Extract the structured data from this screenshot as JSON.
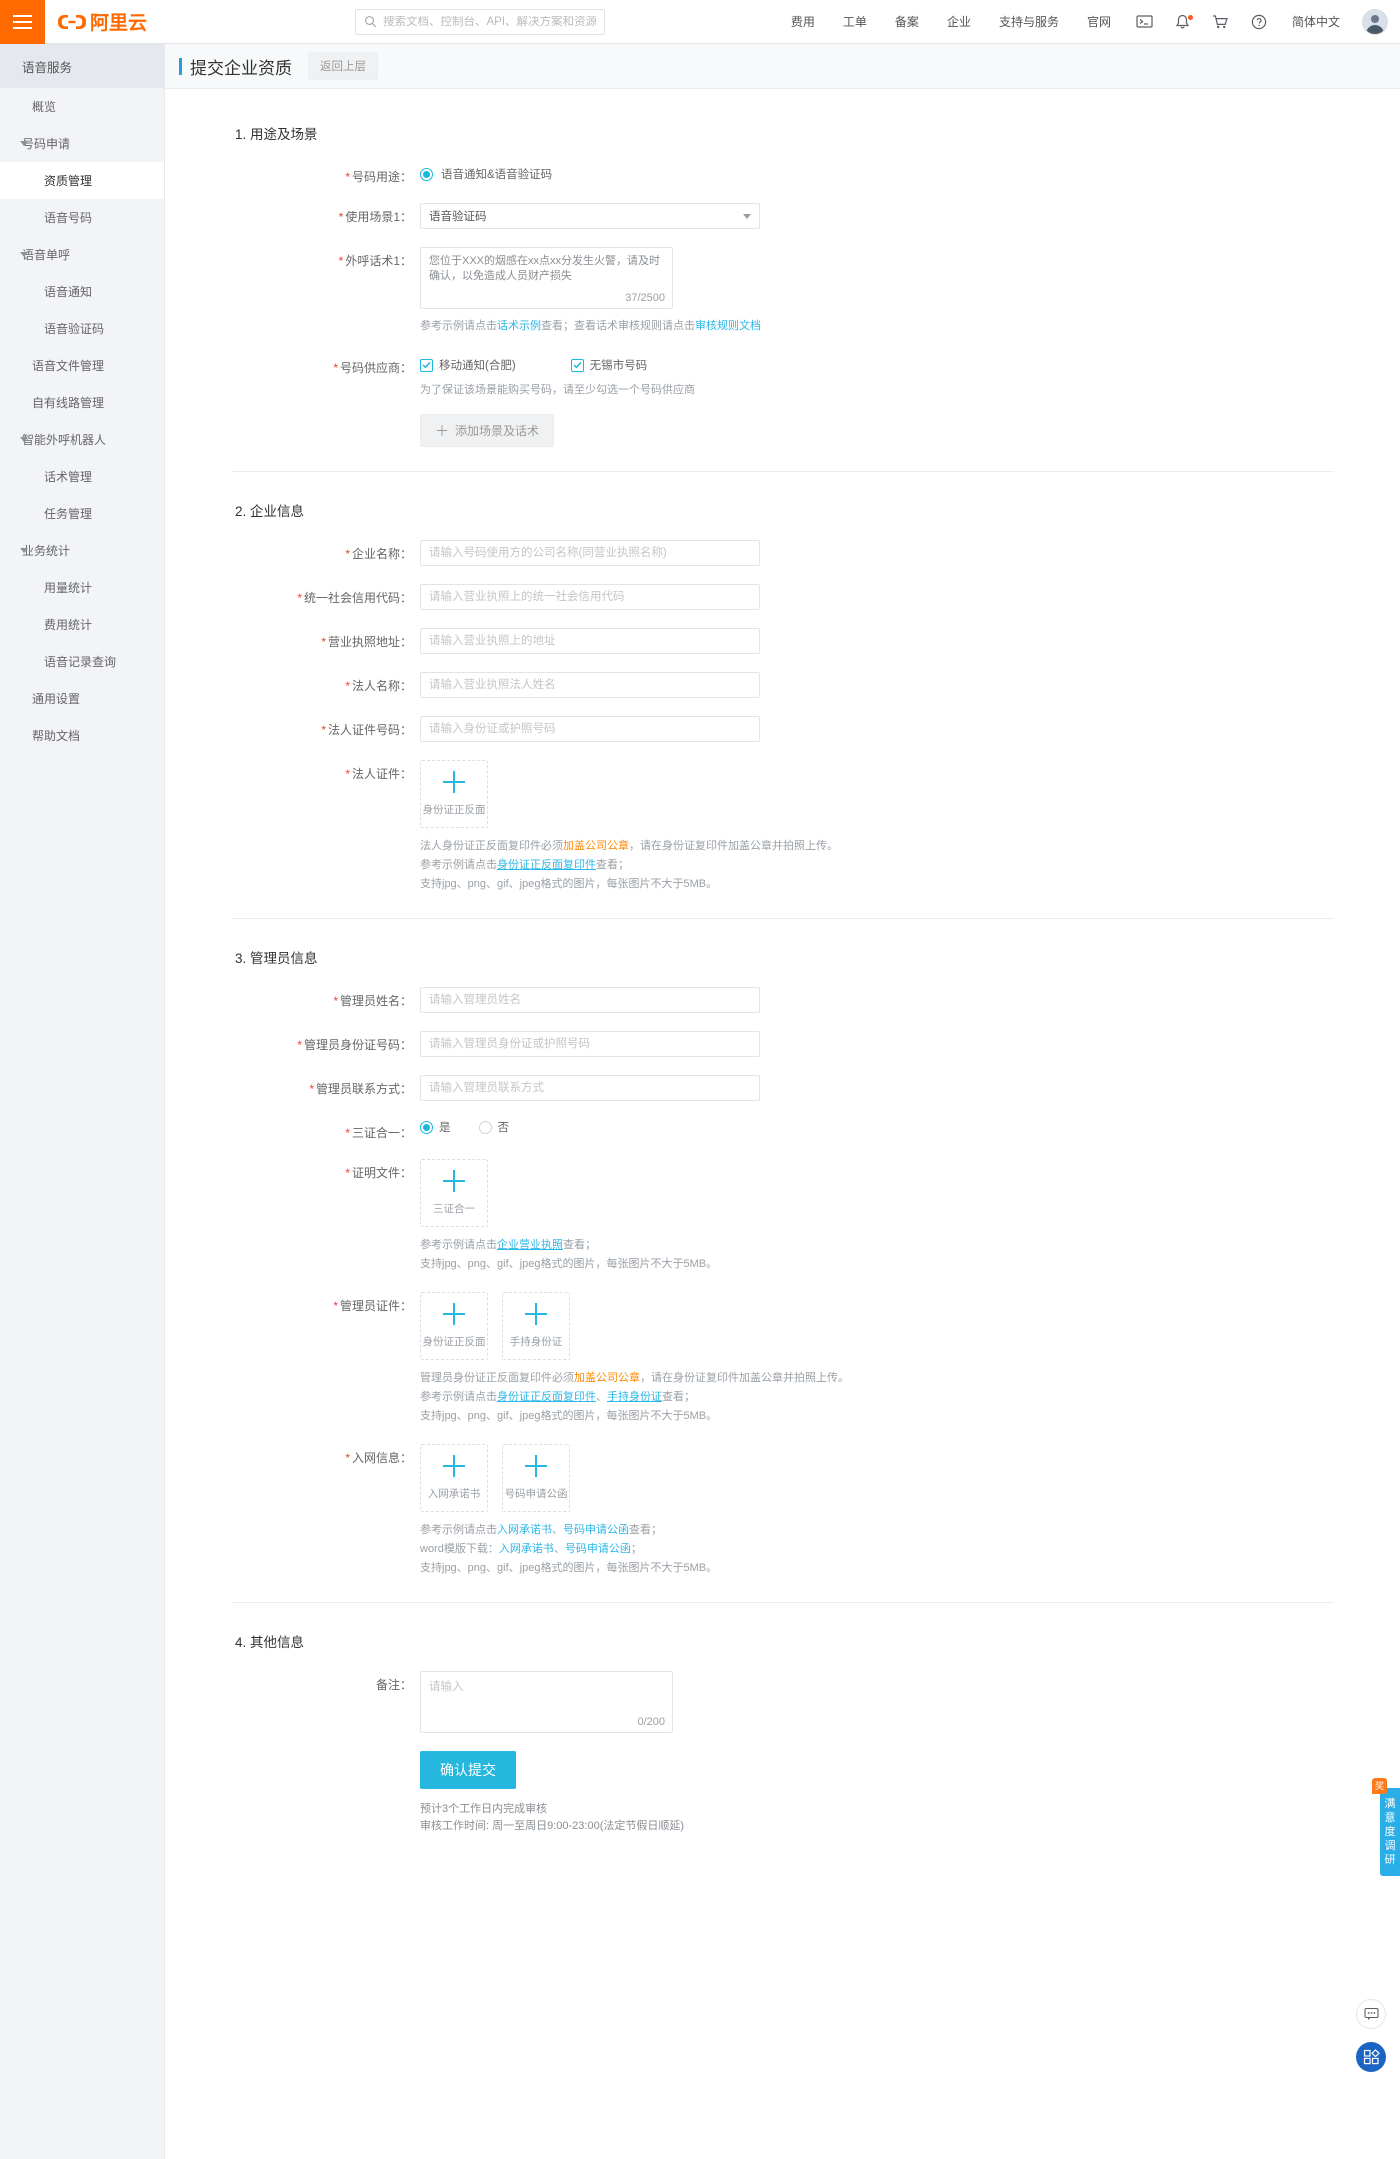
{
  "topbar": {
    "menu_icon": "hamburger-icon",
    "logo_text": "阿里云",
    "search": {
      "placeholder": "搜索文档、控制台、API、解决方案和资源",
      "value": "",
      "icon": "search-icon"
    },
    "nav": [
      {
        "label": "费用"
      },
      {
        "label": "工单"
      },
      {
        "label": "备案"
      },
      {
        "label": "企业"
      },
      {
        "label": "支持与服务"
      },
      {
        "label": "官网"
      }
    ],
    "icons": [
      {
        "name": "terminal-icon"
      },
      {
        "name": "bell-icon",
        "has_dot": true
      },
      {
        "name": "cart-icon"
      },
      {
        "name": "help-icon"
      }
    ],
    "language": "简体中文",
    "avatar": "user-avatar"
  },
  "sidebar": {
    "title": "语音服务",
    "items": [
      {
        "label": "概览",
        "level": 1,
        "group": false,
        "active": false
      },
      {
        "label": "号码申请",
        "level": 0,
        "group": true,
        "active": false
      },
      {
        "label": "资质管理",
        "level": 2,
        "group": false,
        "active": true
      },
      {
        "label": "语音号码",
        "level": 2,
        "group": false,
        "active": false
      },
      {
        "label": "语音单呼",
        "level": 0,
        "group": true,
        "active": false
      },
      {
        "label": "语音通知",
        "level": 2,
        "group": false,
        "active": false
      },
      {
        "label": "语音验证码",
        "level": 2,
        "group": false,
        "active": false
      },
      {
        "label": "语音文件管理",
        "level": 1,
        "group": false,
        "active": false
      },
      {
        "label": "自有线路管理",
        "level": 1,
        "group": false,
        "active": false
      },
      {
        "label": "智能外呼机器人",
        "level": 0,
        "group": true,
        "active": false
      },
      {
        "label": "话术管理",
        "level": 2,
        "group": false,
        "active": false
      },
      {
        "label": "任务管理",
        "level": 2,
        "group": false,
        "active": false
      },
      {
        "label": "业务统计",
        "level": 0,
        "group": true,
        "active": false
      },
      {
        "label": "用量统计",
        "level": 2,
        "group": false,
        "active": false
      },
      {
        "label": "费用统计",
        "level": 2,
        "group": false,
        "active": false
      },
      {
        "label": "语音记录查询",
        "level": 2,
        "group": false,
        "active": false
      },
      {
        "label": "通用设置",
        "level": 1,
        "group": false,
        "active": false
      },
      {
        "label": "帮助文档",
        "level": 1,
        "group": false,
        "active": false
      }
    ]
  },
  "page": {
    "title": "提交企业资质",
    "back_button": "返回上层"
  },
  "section1": {
    "title": "1. 用途及场景",
    "purpose_label": "号码用途：",
    "purpose_option": "语音通知&语音验证码",
    "scene_label": "使用场景1：",
    "scene_value": "语音验证码",
    "script_label": "外呼话术1：",
    "script_value": "您位于XXX的烟感在xx点xx分发生火警，请及时确认，以免造成人员财产损失",
    "script_counter": "37/2500",
    "script_hint_a": "参考示例请点击",
    "script_hint_link1": "话术示例",
    "script_hint_b": "查看；查看话术审核规则请点击",
    "script_hint_link2": "审核规则文档",
    "supplier_label": "号码供应商：",
    "supplier_options": [
      {
        "label": "移动通知(合肥)",
        "checked": true
      },
      {
        "label": "无锡市号码",
        "checked": true
      }
    ],
    "supplier_hint": "为了保证该场景能购买号码，请至少勾选一个号码供应商",
    "add_button": "添加场景及话术"
  },
  "section2": {
    "title": "2. 企业信息",
    "fields": [
      {
        "label": "企业名称：",
        "placeholder": "请输入号码使用方的公司名称(同营业执照名称)",
        "value": ""
      },
      {
        "label": "统一社会信用代码：",
        "placeholder": "请输入营业执照上的统一社会信用代码",
        "value": ""
      },
      {
        "label": "营业执照地址：",
        "placeholder": "请输入营业执照上的地址",
        "value": ""
      },
      {
        "label": "法人名称：",
        "placeholder": "请输入营业执照法人姓名",
        "value": ""
      },
      {
        "label": "法人证件号码：",
        "placeholder": "请输入身份证或护照号码",
        "value": ""
      }
    ],
    "legal_doc_label": "法人证件：",
    "legal_doc_boxes": [
      {
        "caption": "身份证正反面"
      }
    ],
    "legal_note1_a": "法人身份证正反面复印件必须",
    "legal_note1_em": "加盖公司公章",
    "legal_note1_b": "，请在身份证复印件加盖公章并拍照上传。",
    "legal_note2_a": "参考示例请点击",
    "legal_note2_link": "身份证正反面复印件",
    "legal_note2_b": "查看；",
    "legal_note3": "支持jpg、png、gif、jpeg格式的图片，每张图片不大于5MB。"
  },
  "section3": {
    "title": "3. 管理员信息",
    "fields": [
      {
        "label": "管理员姓名：",
        "placeholder": "请输入管理员姓名",
        "value": ""
      },
      {
        "label": "管理员身份证号码：",
        "placeholder": "请输入管理员身份证或护照号码",
        "value": ""
      },
      {
        "label": "管理员联系方式：",
        "placeholder": "请输入管理员联系方式",
        "value": ""
      }
    ],
    "three_in_one_label": "三证合一：",
    "three_in_one_options": [
      {
        "label": "是",
        "selected": true
      },
      {
        "label": "否",
        "selected": false
      }
    ],
    "proof_label": "证明文件：",
    "proof_boxes": [
      {
        "caption": "三证合一"
      }
    ],
    "proof_note1_a": "参考示例请点击",
    "proof_note1_link": "企业营业执照",
    "proof_note1_b": "查看；",
    "proof_note2": "支持jpg、png、gif、jpeg格式的图片，每张图片不大于5MB。",
    "admin_doc_label": "管理员证件：",
    "admin_doc_boxes": [
      {
        "caption": "身份证正反面"
      },
      {
        "caption": "手持身份证"
      }
    ],
    "admin_note1_a": "管理员身份证正反面复印件必须",
    "admin_note1_em": "加盖公司公章",
    "admin_note1_b": "，请在身份证复印件加盖公章并拍照上传。",
    "admin_note2_a": "参考示例请点击",
    "admin_note2_link1": "身份证正反面复印件",
    "admin_note2_sep": "、",
    "admin_note2_link2": "手持身份证",
    "admin_note2_b": "查看；",
    "admin_note3": "支持jpg、png、gif、jpeg格式的图片，每张图片不大于5MB。",
    "network_label": "入网信息：",
    "network_boxes": [
      {
        "caption": "入网承诺书"
      },
      {
        "caption": "号码申请公函"
      }
    ],
    "net_note1_a": "参考示例请点击",
    "net_note1_link1": "入网承诺书",
    "net_note1_sep": "、",
    "net_note1_link2": "号码申请公函",
    "net_note1_b": "查看；",
    "net_note2_a": "word模版下载：",
    "net_note2_link1": "入网承诺书",
    "net_note2_sep": "、",
    "net_note2_link2": "号码申请公函",
    "net_note2_b": "；",
    "net_note3": "支持jpg、png、gif、jpeg格式的图片，每张图片不大于5MB。"
  },
  "section4": {
    "title": "4. 其他信息",
    "remark_label": "备注：",
    "remark_placeholder": "请输入",
    "remark_value": "",
    "remark_counter": "0/200",
    "submit_button": "确认提交",
    "footnote1": "预计3个工作日内完成审核",
    "footnote2": "审核工作时间: 周一至周日9:00-23:00(法定节假日顺延)"
  },
  "floating": {
    "survey_badge": "奖",
    "survey_text": "满意度调研",
    "chat_icon": "chat-bubble-icon",
    "apps_icon": "apps-grid-icon"
  }
}
